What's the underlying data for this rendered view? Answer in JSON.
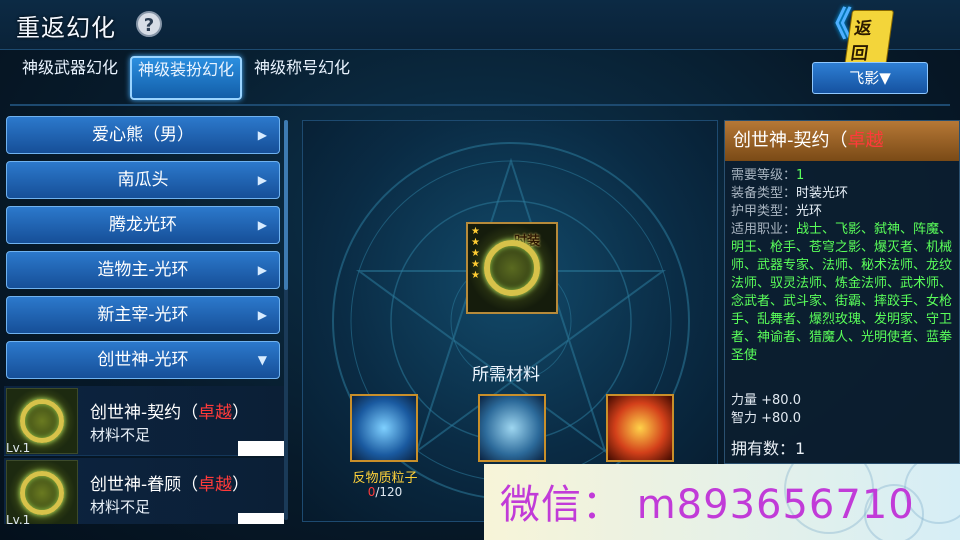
{
  "header": {
    "title": "重返幻化",
    "help_icon": "?",
    "back_label": "返回",
    "back_icon": "double-chevron-left-icon"
  },
  "tabs": [
    {
      "label": "神级武器幻化",
      "active": false
    },
    {
      "label": "神级装扮幻化",
      "active": true
    },
    {
      "label": "神级称号幻化",
      "active": false
    }
  ],
  "filter": {
    "label": "飞影▼"
  },
  "categories": [
    {
      "label": "爱心熊（男）",
      "arrow": "▶"
    },
    {
      "label": "南瓜头",
      "arrow": "▶"
    },
    {
      "label": "腾龙光环",
      "arrow": "▶"
    },
    {
      "label": "造物主-光环",
      "arrow": "▶"
    },
    {
      "label": "新主宰-光环",
      "arrow": "▶"
    },
    {
      "label": "创世神-光环",
      "arrow": "▼"
    }
  ],
  "items": [
    {
      "level": "Lv.1",
      "name": "创世神-契约（",
      "quality": "卓越",
      "name_end": "）",
      "status": "材料不足"
    },
    {
      "level": "Lv.1",
      "name": "创世神-眷顾（",
      "quality": "卓越",
      "name_end": "）",
      "status": "材料不足"
    }
  ],
  "center": {
    "fashion_tag": "时装",
    "stars": "★★★★★",
    "required_label": "所需材料",
    "materials": [
      {
        "name": "反物质粒子",
        "have": "0",
        "need": "/120"
      },
      {
        "name": "",
        "have": "",
        "need": ""
      },
      {
        "name": "",
        "have": "",
        "need": ""
      }
    ]
  },
  "detail": {
    "title": "创世神-契约（",
    "quality": "卓越",
    "title_end": "",
    "rows": [
      {
        "label": "需要等级：",
        "value": "1",
        "color": "green"
      },
      {
        "label": "装备类型：",
        "value": "时装光环",
        "color": "white"
      },
      {
        "label": "护甲类型：",
        "value": "光环",
        "color": "white"
      }
    ],
    "jobs_label": "适用职业：",
    "jobs": "战士、飞影、弑神、阵魔、明王、枪手、苍穹之影、爆灭者、机械师、武器专家、法师、秘术法师、龙纹法师、驭灵法师、炼金法师、武术师、念武者、武斗家、街霸、摔跤手、女枪手、乱舞者、爆烈玫瑰、发明家、守卫者、神谕者、猎魔人、光明使者、蓝拳圣使",
    "stats": [
      "力量 +80.0",
      "智力 +80.0"
    ],
    "owned": "拥有数：1"
  },
  "watermark": "微信： m893656710",
  "colors": {
    "accent": "#2c79cc",
    "quality_red": "#ff3a3a",
    "job_green": "#5aff5a",
    "material_gold": "#ffd23a"
  }
}
